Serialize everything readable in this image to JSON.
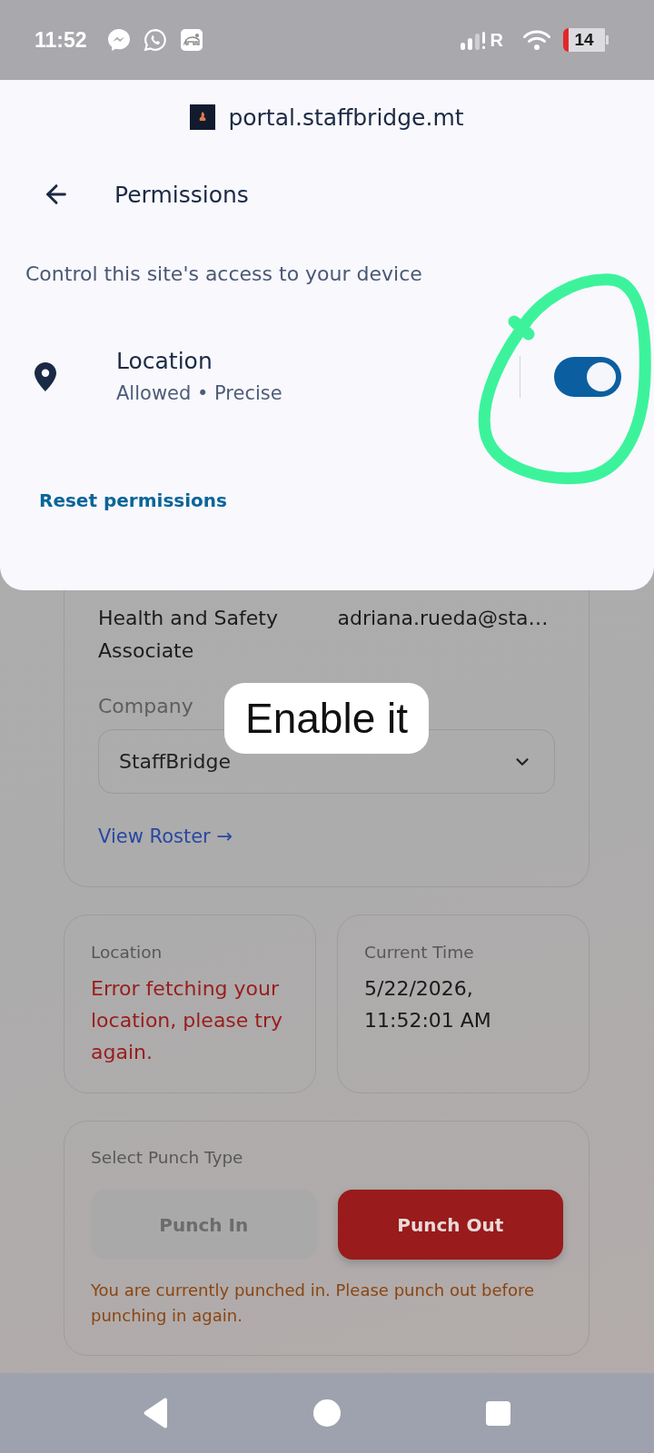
{
  "status_bar": {
    "time": "11:52",
    "network_label": "R",
    "battery": "14"
  },
  "sheet": {
    "site": "portal.staffbridge.mt",
    "title": "Permissions",
    "description": "Control this site's access to your device",
    "permissions": [
      {
        "name": "Location",
        "status": "Allowed • Precise",
        "on": true
      }
    ],
    "reset_link": "Reset permissions"
  },
  "profile_card": {
    "position": "Health and Safety Associate",
    "email": "adriana.rueda@sta…",
    "company_label": "Company",
    "company": "StaffBridge",
    "roster_link": "View Roster →"
  },
  "info_cards": [
    {
      "kind": "error",
      "label": "Location",
      "value": "Error fetching your location, please try again."
    },
    {
      "kind": "plain",
      "label": "Current Time",
      "value": "5/22/2026, 11:52:01 AM"
    }
  ],
  "punch": {
    "title": "Select Punch Type",
    "buttons": [
      {
        "label": "Punch In",
        "disabled": true
      },
      {
        "label": "Punch Out",
        "disabled": false
      }
    ],
    "message": "You are currently punched in. Please punch out before punching in again."
  },
  "annotation": {
    "text": "Enable it"
  }
}
